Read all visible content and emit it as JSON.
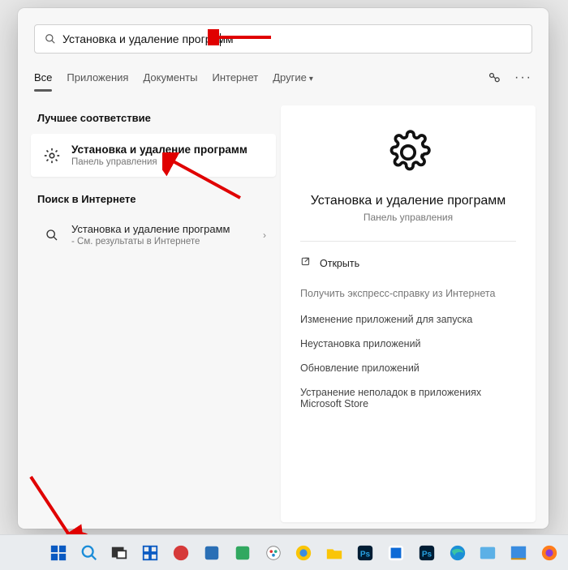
{
  "search": {
    "query": "Установка и удаление программ"
  },
  "tabs": {
    "all": "Все",
    "apps": "Приложения",
    "docs": "Документы",
    "internet": "Интернет",
    "more": "Другие"
  },
  "left": {
    "best_match": "Лучшее соответствие",
    "result": {
      "title": "Установка и удаление программ",
      "subtitle": "Панель управления"
    },
    "web_header": "Поиск в Интернете",
    "web_item": {
      "title": "Установка и удаление программ",
      "subtitle": "- См. результаты в Интернете"
    }
  },
  "right": {
    "title": "Установка и удаление программ",
    "subtitle": "Панель управления",
    "open": "Открыть",
    "help_header": "Получить экспресс-справку из Интернета",
    "links": [
      "Изменение приложений для запуска",
      "Неустановка приложений",
      "Обновление приложений",
      "Устранение неполадок в приложениях Microsoft Store"
    ]
  }
}
